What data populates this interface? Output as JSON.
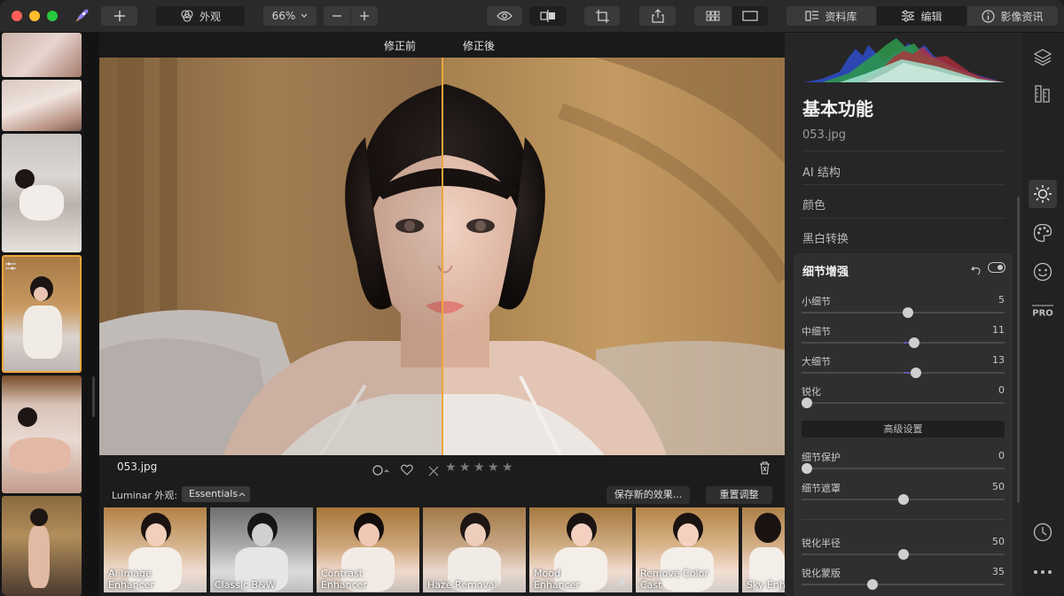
{
  "toolbar": {
    "looks_label": "外观",
    "zoom": "66%",
    "tabs": [
      {
        "label": "资料库"
      },
      {
        "label": "编辑"
      },
      {
        "label": "影像资讯"
      }
    ]
  },
  "viewer": {
    "before_label": "修正前",
    "after_label": "修正後"
  },
  "info": {
    "filename": "053.jpg",
    "stars": [
      "★",
      "★",
      "★",
      "★",
      "★"
    ]
  },
  "looks": {
    "label": "Luminar 外观:",
    "selected": "Essentials",
    "save_button": "保存新的效果...",
    "reset_button": "重置调整",
    "items": [
      {
        "name": "AI Image Enhancer"
      },
      {
        "name": "Classic B&W"
      },
      {
        "name": "Contrast Enhancer"
      },
      {
        "name": "Haze Removal"
      },
      {
        "name": "Mood Enhancer"
      },
      {
        "name": "Remove Color Cast"
      },
      {
        "name": "Sky Enha"
      }
    ]
  },
  "panel": {
    "title": "基本功能",
    "filename": "053.jpg",
    "sections": [
      {
        "label": "AI 结构"
      },
      {
        "label": "颜色"
      },
      {
        "label": "黑白转换"
      }
    ],
    "detail": {
      "title": "细节增强",
      "advanced_button": "高级设置",
      "sliders": [
        {
          "label": "小细节",
          "value": "5",
          "level": 0.525
        },
        {
          "label": "中细节",
          "value": "11",
          "level": 0.555
        },
        {
          "label": "大细节",
          "value": "13",
          "level": 0.565
        },
        {
          "label": "锐化",
          "value": "0",
          "level": 0.0
        },
        {
          "label": "细节保护",
          "value": "0",
          "level": 0.0
        },
        {
          "label": "细节遮罩",
          "value": "50",
          "level": 0.5
        },
        {
          "label": "锐化半径",
          "value": "50",
          "level": 0.5
        },
        {
          "label": "锐化蒙版",
          "value": "35",
          "level": 0.35
        }
      ]
    }
  },
  "colors": {
    "accent": "#f0a63a",
    "slider_fill": "#5b5aa8"
  }
}
